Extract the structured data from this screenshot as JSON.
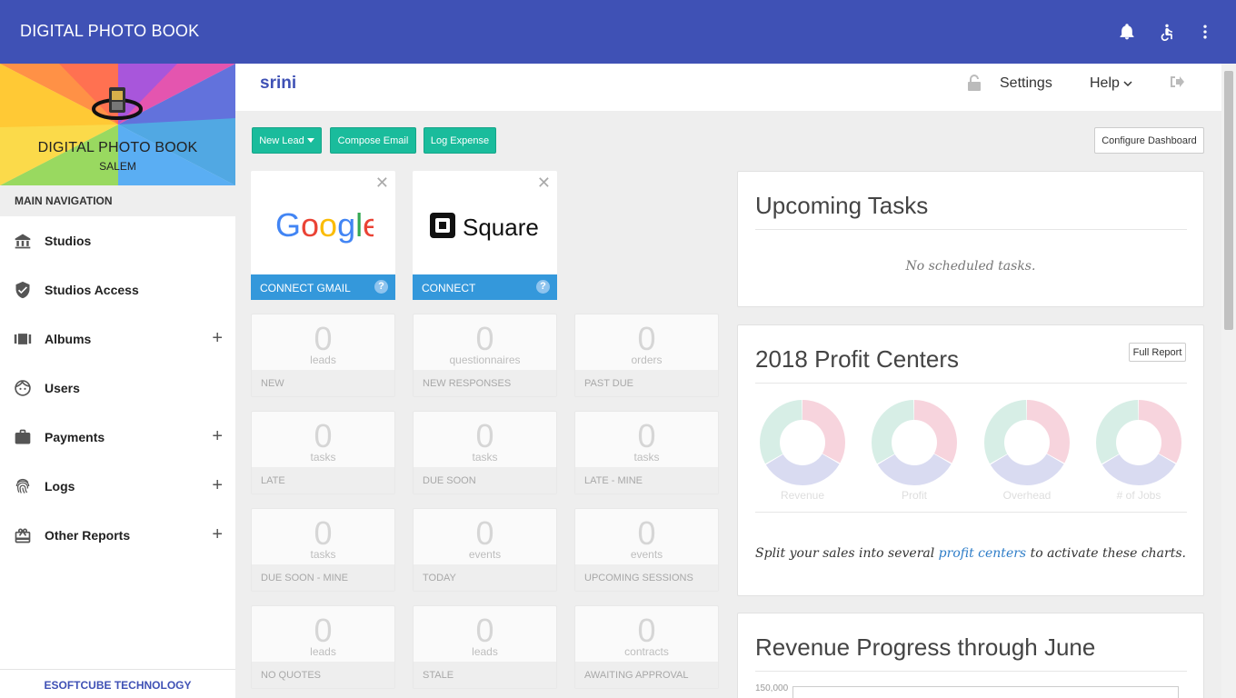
{
  "header": {
    "app_title": "DIGITAL PHOTO BOOK",
    "icons": [
      "bell-icon",
      "accessibility-icon",
      "more-vert-icon"
    ]
  },
  "sidebar": {
    "brand_name": "DIGITAL PHOTO BOOK",
    "brand_sub": "SALEM",
    "nav_header": "MAIN NAVIGATION",
    "items": [
      {
        "label": "Studios",
        "icon": "bank-icon",
        "expandable": false
      },
      {
        "label": "Studios Access",
        "icon": "shield-check-icon",
        "expandable": false
      },
      {
        "label": "Albums",
        "icon": "albums-icon",
        "expandable": true
      },
      {
        "label": "Users",
        "icon": "face-icon",
        "expandable": false
      },
      {
        "label": "Payments",
        "icon": "briefcase-icon",
        "expandable": true
      },
      {
        "label": "Logs",
        "icon": "fingerprint-icon",
        "expandable": true
      },
      {
        "label": "Other Reports",
        "icon": "gift-icon",
        "expandable": true
      }
    ],
    "plus_symbol": "+",
    "footer": "ESOFTCUBE TECHNOLOGY"
  },
  "subheader": {
    "username": "srini",
    "settings": "Settings",
    "help": "Help"
  },
  "actions": {
    "new_lead": "New Lead",
    "compose_email": "Compose Email",
    "log_expense": "Log Expense",
    "configure_dashboard": "Configure Dashboard"
  },
  "integrations": [
    {
      "logo_text": "Google",
      "footer": "CONNECT GMAIL",
      "help": "?",
      "close": "✕"
    },
    {
      "logo_text": "Square",
      "footer": "CONNECT",
      "help": "?",
      "close": "✕"
    }
  ],
  "stats": [
    {
      "value": "0",
      "unit": "leads",
      "label": "NEW"
    },
    {
      "value": "0",
      "unit": "questionnaires",
      "label": "NEW RESPONSES"
    },
    {
      "value": "0",
      "unit": "orders",
      "label": "PAST DUE"
    },
    {
      "value": "0",
      "unit": "tasks",
      "label": "LATE"
    },
    {
      "value": "0",
      "unit": "tasks",
      "label": "DUE SOON"
    },
    {
      "value": "0",
      "unit": "tasks",
      "label": "LATE - MINE"
    },
    {
      "value": "0",
      "unit": "tasks",
      "label": "DUE SOON - MINE"
    },
    {
      "value": "0",
      "unit": "events",
      "label": "TODAY"
    },
    {
      "value": "0",
      "unit": "events",
      "label": "UPCOMING SESSIONS"
    },
    {
      "value": "0",
      "unit": "leads",
      "label": "NO QUOTES"
    },
    {
      "value": "0",
      "unit": "leads",
      "label": "STALE"
    },
    {
      "value": "0",
      "unit": "contracts",
      "label": "AWAITING APPROVAL"
    }
  ],
  "tasks_panel": {
    "title": "Upcoming Tasks",
    "empty": "No scheduled tasks."
  },
  "profit_panel": {
    "title": "2018 Profit Centers",
    "full_report": "Full Report",
    "donuts": [
      "Revenue",
      "Profit",
      "Overhead",
      "# of Jobs"
    ],
    "colors": [
      "#f7d4dd",
      "#d9dbf1",
      "#d7eee6"
    ],
    "text_before": "Split your sales into several",
    "link": "profit centers",
    "text_after": "to activate these charts."
  },
  "revenue_panel": {
    "title": "Revenue Progress through June",
    "axis_top": "150,000"
  }
}
